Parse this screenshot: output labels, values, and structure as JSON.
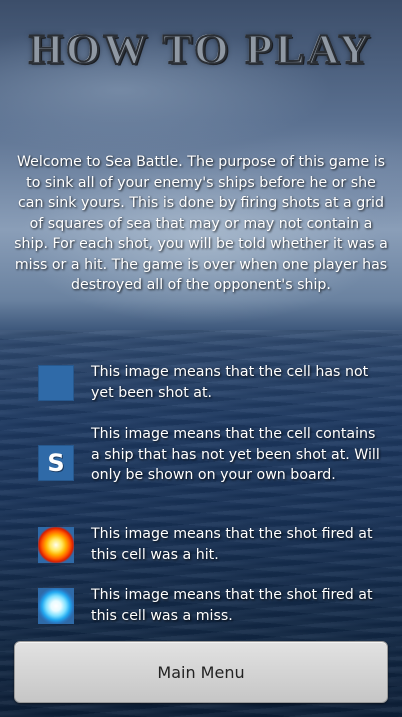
{
  "header": {
    "title": "HOW TO PLAY"
  },
  "intro": {
    "text": "Welcome to Sea Battle. The purpose of this game is to sink all of your enemy's ships before he or she can sink yours. This is done by firing shots at a grid of squares of sea that may or may not contain a ship. For each shot, you will be told whether it was a miss or a hit. The game is over when one player has destroyed all of the opponent's ship."
  },
  "legend": [
    {
      "icon": "empty-cell-icon",
      "text": "This image means that the cell has not yet been shot at."
    },
    {
      "icon": "ship-cell-icon",
      "icon_letter": "S",
      "text": "This image means that the cell contains a ship that has not yet been shot at. Will only be shown on your own board."
    },
    {
      "icon": "hit-cell-icon",
      "text": "This image means that the shot fired at this cell was a hit."
    },
    {
      "icon": "miss-cell-icon",
      "text": "This image means that the shot fired at this cell was a miss."
    }
  ],
  "footer": {
    "main_menu_label": "Main Menu"
  },
  "colors": {
    "cell_blue": "#2f6aa8",
    "hit": "#ff5a00",
    "miss": "#22a8f0"
  }
}
